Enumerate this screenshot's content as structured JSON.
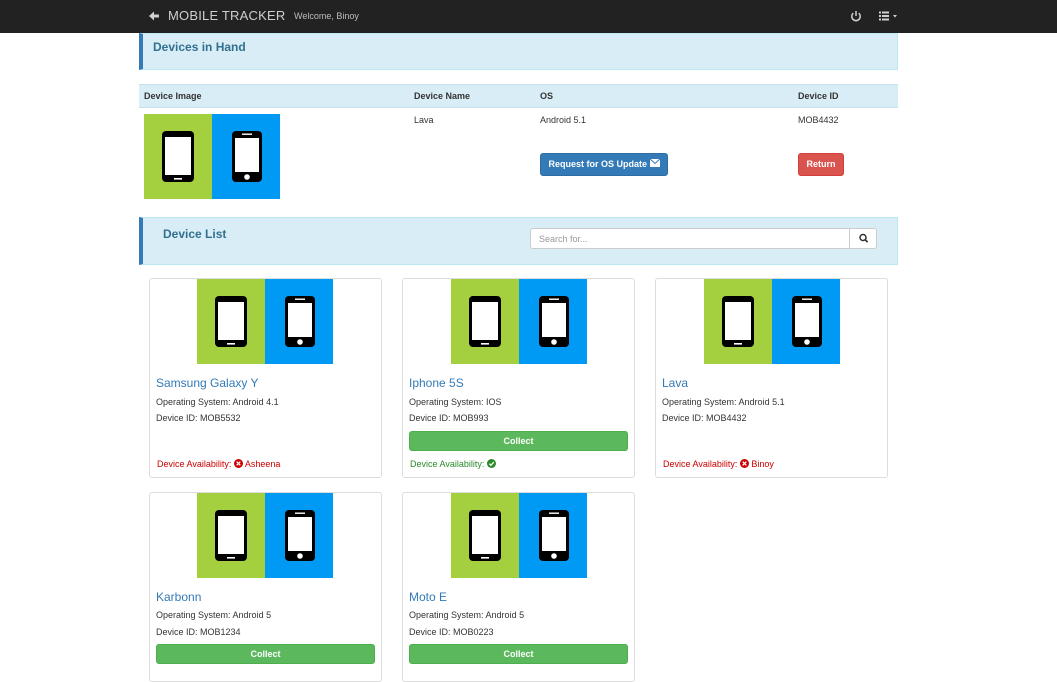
{
  "nav": {
    "brand": "MOBILE TRACKER",
    "welcome": "Welcome, Binoy"
  },
  "hand": {
    "title": "Devices in Hand",
    "headers": [
      "Device Image",
      "Device Name",
      "OS",
      "Device ID"
    ],
    "row": {
      "name": "Lava",
      "os": "Android 5.1",
      "id": "MOB4432",
      "update_label": "Request for OS Update",
      "return_label": "Return"
    }
  },
  "list": {
    "title": "Device List",
    "search_placeholder": "Search for...",
    "os_prefix": "Operating System:",
    "id_prefix": "Device ID:",
    "availability_label": "Device Availability:",
    "collect_label": "Collect",
    "devices": [
      {
        "name": "Samsung Galaxy Y",
        "os": "Android 4.1",
        "id": "MOB5532",
        "available": false,
        "holder": "Asheena"
      },
      {
        "name": "Iphone 5S",
        "os": "IOS",
        "id": "MOB993",
        "available": true,
        "holder": ""
      },
      {
        "name": "Lava",
        "os": "Android 5.1",
        "id": "MOB4432",
        "available": false,
        "holder": "Binoy"
      },
      {
        "name": "Karbonn",
        "os": "Android 5",
        "id": "MOB1234",
        "available": true,
        "holder": ""
      },
      {
        "name": "Moto E",
        "os": "Android 5",
        "id": "MOB0223",
        "available": true,
        "holder": ""
      }
    ]
  },
  "colors": {
    "image_left": "#a4cf3f",
    "image_right": "#0099f3",
    "panel_bg": "#d9edf7",
    "accent": "#337ab7"
  }
}
